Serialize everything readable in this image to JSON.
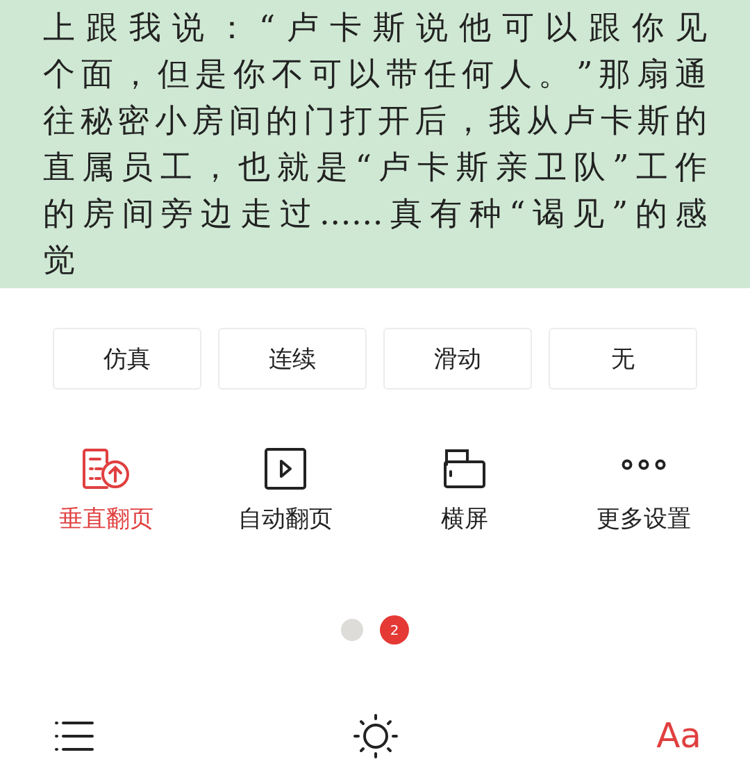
{
  "reader": {
    "lines": [
      "上跟我说：“卢卡斯说他可以跟你见",
      "个面，但是你不可以带任何人。”那扇通",
      "往秘密小房间的门打开后，我从卢卡斯的",
      "直属员工，也就是“卢卡斯亲卫队”工作",
      "的房间旁边走过……真有种“谒见”的感",
      "觉"
    ]
  },
  "page_modes": [
    {
      "label": "仿真"
    },
    {
      "label": "连续"
    },
    {
      "label": "滑动"
    },
    {
      "label": "无"
    }
  ],
  "actions": [
    {
      "kind": "vertical",
      "label": "垂直翻页",
      "selected": true
    },
    {
      "kind": "auto",
      "label": "自动翻页",
      "selected": false
    },
    {
      "kind": "landscape",
      "label": "横屏",
      "selected": false
    },
    {
      "kind": "more",
      "label": "更多设置",
      "selected": false
    }
  ],
  "pager": [
    {
      "selected": false
    },
    {
      "label": "2",
      "selected": true
    }
  ],
  "bottom_bar": {
    "font_button": {
      "label": "Aa",
      "selected": true
    }
  }
}
